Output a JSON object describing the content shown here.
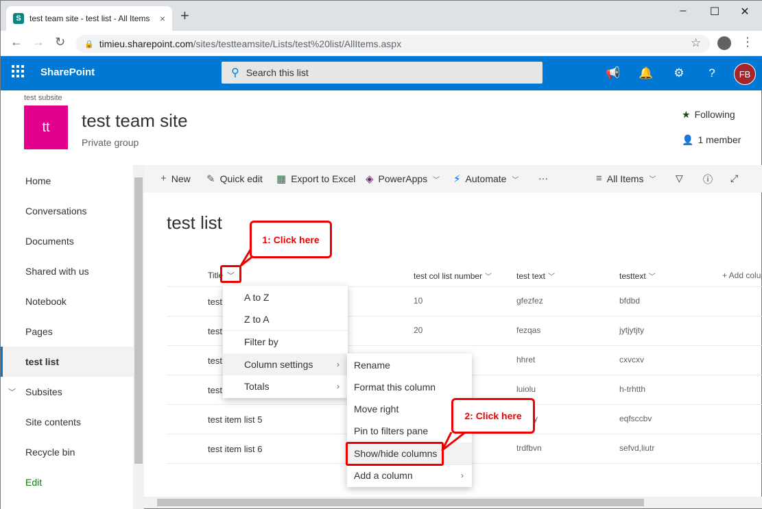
{
  "browser": {
    "tab_title": "test team site - test list - All Items",
    "tab_close": "×",
    "new_tab": "+",
    "url_host": "timieu.sharepoint.com",
    "url_path": "/sites/testteamsite/Lists/test%20list/AllItems.aspx",
    "win_min": "–",
    "win_max": "☐",
    "win_close": "✕"
  },
  "suite": {
    "brand": "SharePoint",
    "search_placeholder": "Search this list",
    "avatar_initials": "FB"
  },
  "site": {
    "subsite_label": "test subsite",
    "logo_text": "tt",
    "title": "test team site",
    "subtitle": "Private group",
    "following_label": "Following",
    "members_label": "1 member"
  },
  "nav": {
    "items": [
      {
        "label": "Home"
      },
      {
        "label": "Conversations"
      },
      {
        "label": "Documents"
      },
      {
        "label": "Shared with us"
      },
      {
        "label": "Notebook"
      },
      {
        "label": "Pages"
      },
      {
        "label": "test list"
      },
      {
        "label": "Subsites"
      },
      {
        "label": "Site contents"
      },
      {
        "label": "Recycle bin"
      },
      {
        "label": "Edit"
      }
    ]
  },
  "commands": {
    "new": "New",
    "quick_edit": "Quick edit",
    "export": "Export to Excel",
    "powerapps": "PowerApps",
    "automate": "Automate",
    "more": "···",
    "view": "All Items"
  },
  "list": {
    "title": "test list",
    "columns": [
      "Title",
      "test col list number",
      "test text",
      "testtext",
      "+ Add column"
    ],
    "rows": [
      {
        "title": "test",
        "number": "10",
        "text": "gfezfez",
        "text2": "bfdbd"
      },
      {
        "title": "test",
        "number": "20",
        "text": "fezqas",
        "text2": "jytjytjty"
      },
      {
        "title": "test",
        "number": "",
        "text": "hhret",
        "text2": "cxvcxv"
      },
      {
        "title": "test",
        "number": "",
        "text": "luiolu",
        "text2": "h-trhtth"
      },
      {
        "title": "test item list 5",
        "number": "",
        "text": "y",
        "text2": "eqfsccbv"
      },
      {
        "title": "test item list 6",
        "number": "",
        "text": "trdfbvn",
        "text2": "sefvd,liutr"
      }
    ]
  },
  "menu1": {
    "items": [
      "A to Z",
      "Z to A",
      "Filter by",
      "Column settings",
      "Totals"
    ]
  },
  "menu2": {
    "items": [
      "Rename",
      "Format this column",
      "Move right",
      "Pin to filters pane",
      "Show/hide columns",
      "Add a column"
    ]
  },
  "callouts": {
    "first": "1: Click here",
    "second": "2: Click here"
  },
  "colors": {
    "suite_bar": "#0078d4",
    "logo": "#e3008c",
    "callout": "#e00000",
    "avatar": "#a4262c"
  },
  "icons": [
    "sharepoint-favicon",
    "lock-icon",
    "star-icon",
    "account-icon",
    "waffle-icon",
    "search-icon",
    "megaphone-icon",
    "bell-icon",
    "gear-icon",
    "help-icon",
    "person-icon",
    "plus-icon",
    "pencil-icon",
    "excel-icon",
    "powerapps-icon",
    "automate-icon",
    "filter-icon",
    "info-icon",
    "expand-icon",
    "chevron-down-icon",
    "chevron-right-icon"
  ]
}
